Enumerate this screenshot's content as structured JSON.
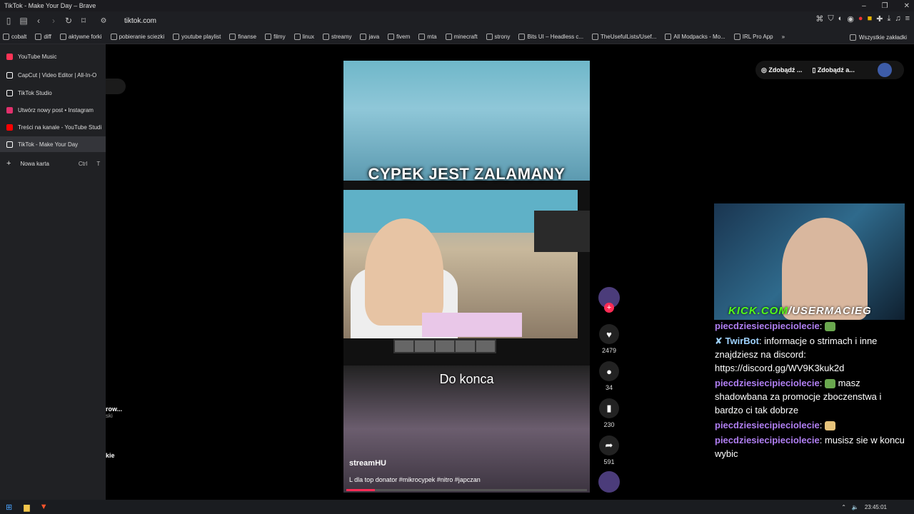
{
  "window": {
    "title": "TikTok - Make Your Day – Brave",
    "minimize": "–",
    "restore": "❐",
    "close": "✕"
  },
  "toolbar": {
    "url": "tiktok.com"
  },
  "bookmarks": [
    {
      "label": "cobalt"
    },
    {
      "label": "diff"
    },
    {
      "label": "aktywne forki"
    },
    {
      "label": "pobieranie sciezki"
    },
    {
      "label": "youtube playlist"
    },
    {
      "label": "finanse"
    },
    {
      "label": "filmy"
    },
    {
      "label": "linux"
    },
    {
      "label": "streamy"
    },
    {
      "label": "java"
    },
    {
      "label": "fivem"
    },
    {
      "label": "mta"
    },
    {
      "label": "minecraft"
    },
    {
      "label": "strony"
    },
    {
      "label": "Bits UI – Headless c..."
    },
    {
      "label": "TheUsefulLists/Usef..."
    },
    {
      "label": "All Modpacks - Mo..."
    },
    {
      "label": "IRL Pro App"
    }
  ],
  "bookmarks_more": "»",
  "bookmarks_all": "Wszystkie zakładki",
  "sidebar": {
    "tabs": [
      {
        "label": "YouTube Music",
        "color": "#ff3355"
      },
      {
        "label": "CapCut | Video Editor | All-In-O",
        "color": "#ffffff"
      },
      {
        "label": "TikTok Studio",
        "color": "#ffffff"
      },
      {
        "label": "Utwórz nowy post • Instagram",
        "color": "#e1306c"
      },
      {
        "label": "Treści na kanale - YouTube Studi",
        "color": "#ff0000"
      },
      {
        "label": "TikTok - Make Your Day",
        "color": "#ffffff"
      }
    ],
    "new_tab": {
      "label": "Nowa karta",
      "shortcut_ctrl": "Ctrl",
      "shortcut_key": "T",
      "icon": "+"
    }
  },
  "header": {
    "get_coins": "Zdobądź ...",
    "get_app": "Zdobądź a..."
  },
  "video": {
    "caption_top": "CYPEK JEST ZALAMANY",
    "caption_bottom": "Do konca",
    "author": "streamHU",
    "description": "L dla top donator #mikrocypek #nitro #japczan",
    "progress_percent": 12
  },
  "actions": {
    "likes": "2479",
    "comments": "34",
    "saves": "230",
    "shares": "591"
  },
  "stream_overlay": {
    "kick_prefix": "KICK.COM",
    "kick_suffix": "/USERMACIEG"
  },
  "chat": [
    {
      "user": "piecdziesiecipieciolecie",
      "text": ""
    },
    {
      "user": "TwirBot",
      "text": "informacje o strimach i inne znajdziesz na discord: https://discord.gg/WV9K3kuk2d"
    },
    {
      "user": "piecdziesiecipieciolecie",
      "text": "masz shadowbana za promocje zboczenstwa i bardzo ci tak dobrze"
    },
    {
      "user": "piecdziesiecipieciolecie",
      "text": ""
    },
    {
      "user": "piecdziesiecipieciolecie",
      "text": "musisz sie w koncu wybic"
    }
  ],
  "partial": {
    "line1": "row...",
    "line2": "ski",
    "line3": "kie"
  },
  "taskbar": {
    "time": "23:45:01"
  }
}
